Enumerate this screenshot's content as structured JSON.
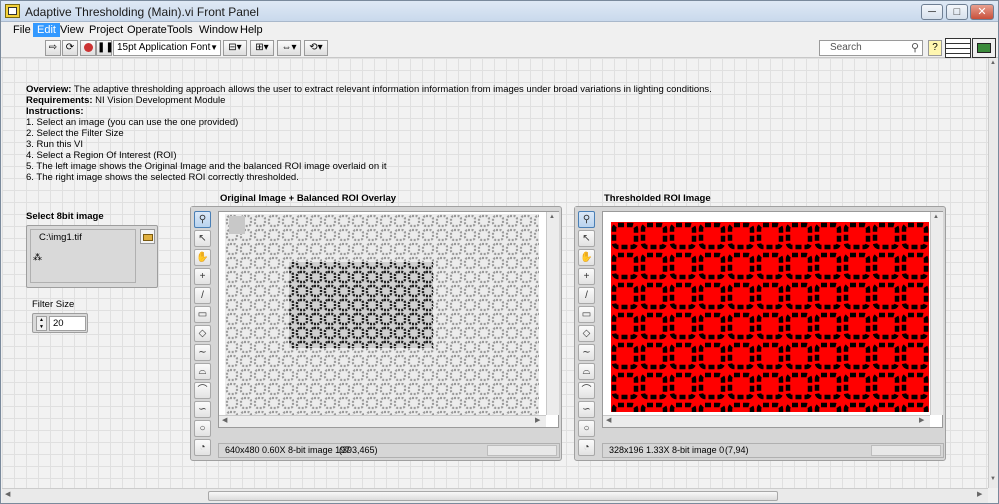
{
  "window": {
    "title": "Adaptive Thresholding (Main).vi Front Panel",
    "min_glyph": "─",
    "max_glyph": "□",
    "close_glyph": "✕"
  },
  "menu": [
    "File",
    "Edit",
    "View",
    "Project",
    "Operate",
    "Tools",
    "Window",
    "Help"
  ],
  "toolbar": {
    "font_label": "15pt Application Font",
    "search_placeholder": "Search"
  },
  "description": {
    "overview_label": "Overview:",
    "overview_text": " The adaptive thresholding approach allows the user to extract relevant information information from images under broad variations in lighting conditions.",
    "requirements_label": "Requirements:",
    "requirements_text": " NI Vision Development Module",
    "instructions_label": "Instructions:",
    "steps": [
      "1. Select an image (you can use the one provided)",
      "2. Select the Filter Size",
      "3. Run this VI",
      "4. Select a Region Of Interest (ROI)",
      "5. The left image shows the Original Image and the balanced ROI image overlaid on it",
      "6. The right image shows the selected ROI correctly thresholded."
    ]
  },
  "controls": {
    "image_label": "Select 8bit image",
    "image_path": "C:\\img1.tif",
    "filter_label": "Filter Size",
    "filter_value": "20"
  },
  "left_display": {
    "title": "Original Image + Balanced ROI Overlay",
    "status": "640x480 0.60X 8-bit image 197",
    "coords": "(393,465)"
  },
  "right_display": {
    "title": "Thresholded ROI Image",
    "status": "328x196 1.33X 8-bit image 0",
    "coords": "(7,94)"
  },
  "colors": {
    "threshold_fg": "#000000",
    "threshold_bg": "#ff0000",
    "menu_highlight": "#3399ff"
  },
  "tools": [
    "zoom-icon",
    "pointer-icon",
    "pan-icon",
    "crosshair-icon",
    "line-icon",
    "rectangle-icon",
    "rotated-rect-icon",
    "freehand-line-icon",
    "annulus-arc-icon",
    "polyline-icon",
    "freehand-region-icon",
    "ellipse-icon",
    "annulus-icon"
  ]
}
